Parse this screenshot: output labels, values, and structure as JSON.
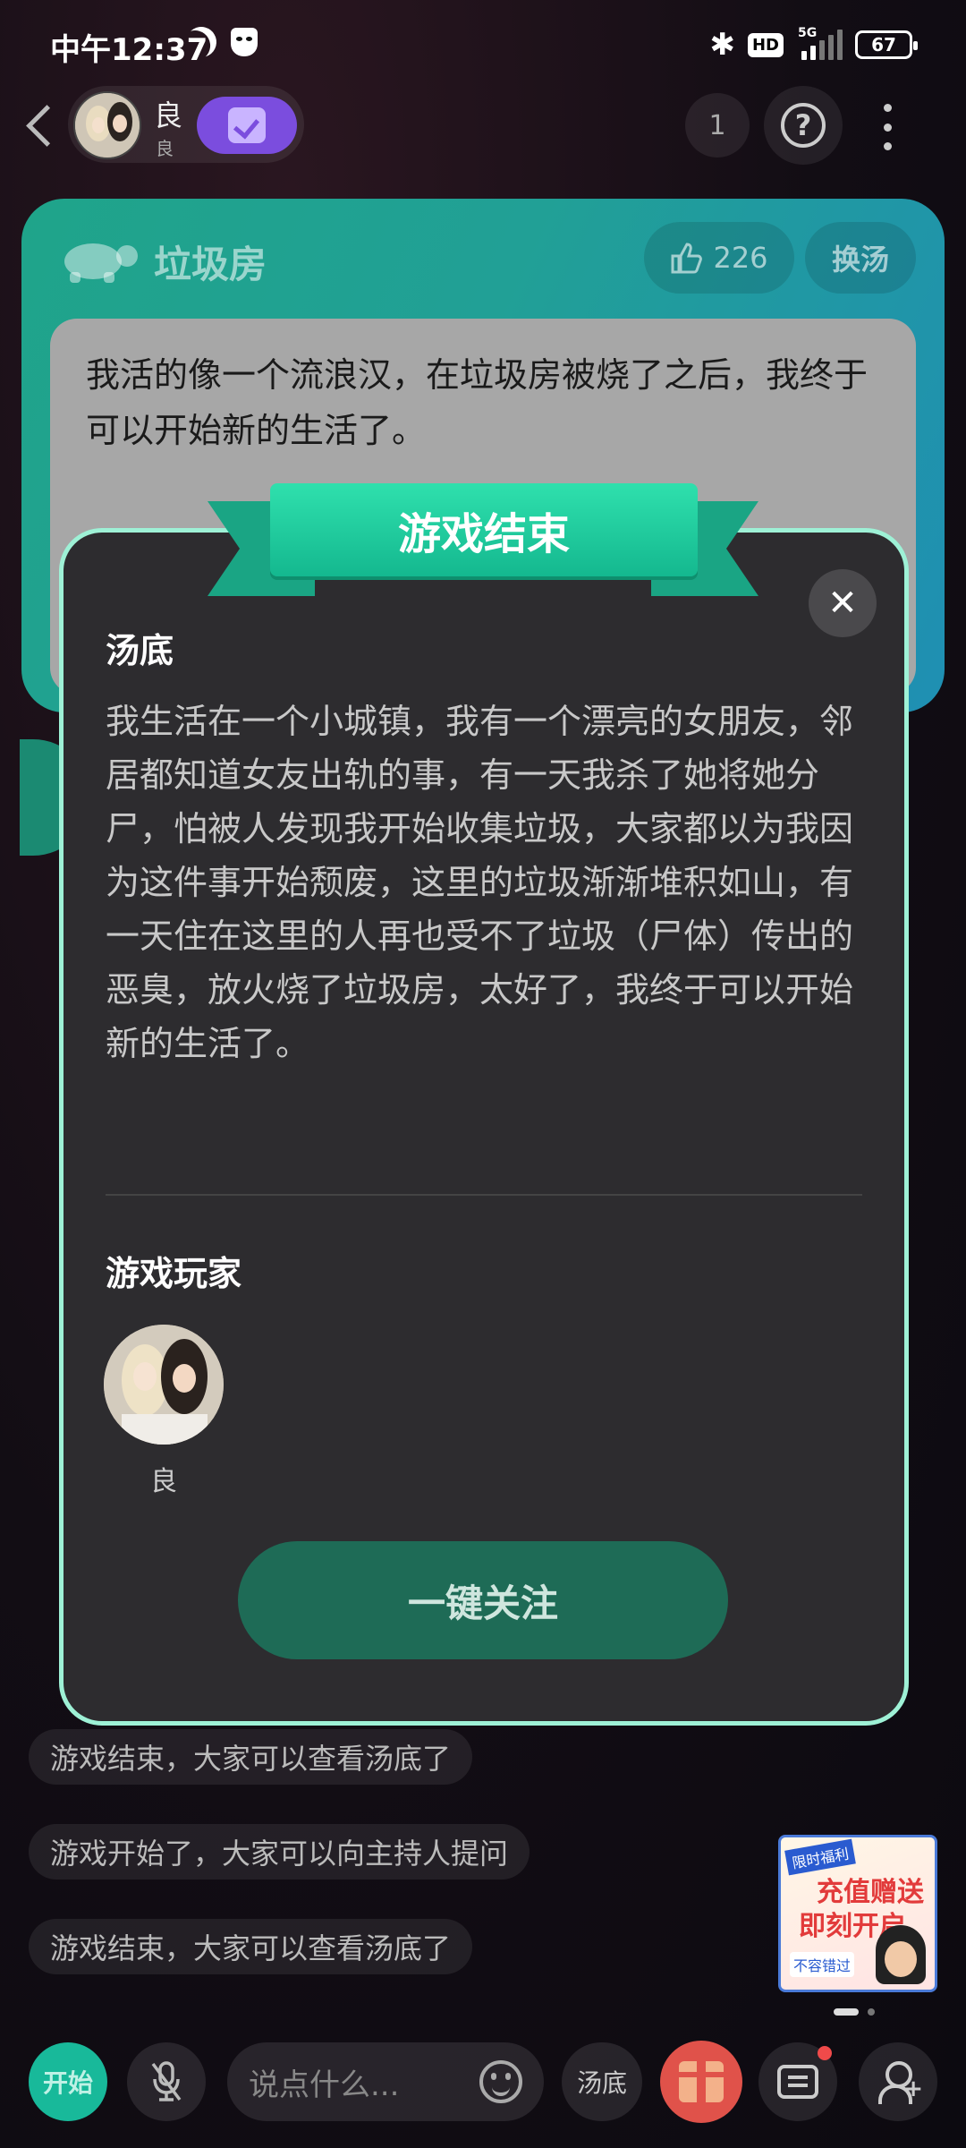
{
  "status_bar": {
    "time": "中午12:37",
    "network": "5G",
    "hd": "HD",
    "battery": "67"
  },
  "header": {
    "room_name": "良",
    "room_sub": "良",
    "count": "1",
    "help": "?"
  },
  "soup_card": {
    "title": "垃圾房",
    "likes": "226",
    "swap_label": "换汤",
    "question": "我活的像一个流浪汉，在垃圾房被烧了之后，我终于可以开始新的生活了。"
  },
  "chat": [
    "游戏结束，大家可以查看汤底了",
    "游戏开始了，大家可以向主持人提问",
    "游戏结束，大家可以查看汤底了"
  ],
  "modal": {
    "banner": "游戏结束",
    "answer_title": "汤底",
    "answer": "我生活在一个小城镇，我有一个漂亮的女朋友，邻居都知道女友出轨的事，有一天我杀了她将她分尸，怕被人发现我开始收集垃圾，大家都以为我因为这件事开始颓废，这里的垃圾渐渐堆积如山，有一天住在这里的人再也受不了垃圾（尸体）传出的恶臭，放火烧了垃圾房，太好了，我终于可以开始新的生活了。",
    "players_title": "游戏玩家",
    "players": [
      {
        "name": "良"
      }
    ],
    "follow_label": "一键关注"
  },
  "ad": {
    "tag": "限时福利",
    "line1": "充值赠送",
    "line2": "即刻开启",
    "tag2": "不容错过"
  },
  "bottom_bar": {
    "start_label": "开始",
    "input_placeholder": "说点什么...",
    "soup_label": "汤底"
  },
  "colors": {
    "accent": "#18b99a",
    "modal_border": "#9ef1d6",
    "banner": "#2fe0ad",
    "check_pill": "#7b4dde"
  }
}
